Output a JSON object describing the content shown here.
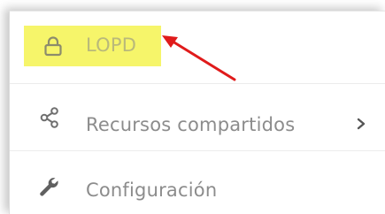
{
  "menu": {
    "items": [
      {
        "label": "LOPD",
        "icon": "lock-icon",
        "highlighted": true
      },
      {
        "label": "Recursos compartidos",
        "icon": "share-icon",
        "has_submenu": true
      },
      {
        "label": "Configuración",
        "icon": "wrench-icon"
      }
    ]
  },
  "colors": {
    "highlight": "#f6f56a",
    "annotation_arrow": "#e01b1b",
    "text": "#8c8c8c",
    "icon": "#6f6f6f"
  }
}
